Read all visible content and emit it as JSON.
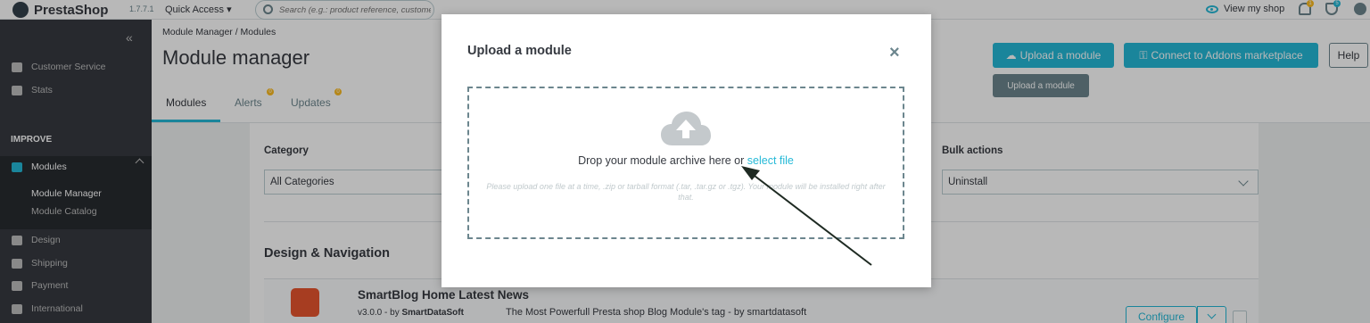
{
  "topbar": {
    "brand": "PrestaShop",
    "version": "1.7.7.1",
    "quick_access": "Quick Access ▾",
    "search_placeholder": "Search (e.g.: product reference, custome",
    "view_shop": "View my shop",
    "notif_count_1": "1",
    "notif_count_2": "5",
    "icons": [
      "bell-icon",
      "trophy-icon",
      "user-icon"
    ]
  },
  "sidebar": {
    "collapse": "«",
    "items_top": [
      {
        "label": "Customer Service",
        "icon": "chat-icon"
      },
      {
        "label": "Stats",
        "icon": "stats-icon"
      }
    ],
    "section_improve": "IMPROVE",
    "modules": {
      "label": "Modules",
      "icon": "puzzle-icon"
    },
    "submenu": [
      "Module Manager",
      "Module Catalog"
    ],
    "items_bottom": [
      {
        "label": "Design",
        "icon": "monitor-icon"
      },
      {
        "label": "Shipping",
        "icon": "truck-icon"
      },
      {
        "label": "Payment",
        "icon": "card-icon"
      },
      {
        "label": "International",
        "icon": "globe-icon"
      }
    ]
  },
  "header": {
    "breadcrumb": "Module Manager  /  Modules",
    "title": "Module manager",
    "tabs": [
      {
        "label": "Modules",
        "active": true
      },
      {
        "label": "Alerts",
        "badge": "0"
      },
      {
        "label": "Updates",
        "badge": "0"
      }
    ],
    "upload_button": "Upload a module",
    "connect_button": "Connect to Addons marketplace",
    "help_button": "Help",
    "tooltip": "Upload a module"
  },
  "filters": {
    "category_label": "Category",
    "category_value": "All Categories",
    "bulk_label": "Bulk actions",
    "bulk_value": "Uninstall"
  },
  "section": {
    "title": "Design & Navigation",
    "module": {
      "name": "SmartBlog Home Latest News",
      "version": "v3.0.0 - by ",
      "author": "SmartDataSoft",
      "description": "The Most Powerfull Presta shop Blog Module's tag - by smartdatasoft",
      "configure": "Configure"
    }
  },
  "modal": {
    "title": "Upload a module",
    "close": "×",
    "drop_text": "Drop your module archive here or ",
    "select_file": "select file",
    "help": "Please upload one file at a time, .zip or tarball format (.tar, .tar.gz or .tgz). Your module will be installed right after that."
  },
  "colors": {
    "accent": "#25b9d7",
    "sidebar": "#363a41",
    "module_icon": "#e8552f"
  }
}
